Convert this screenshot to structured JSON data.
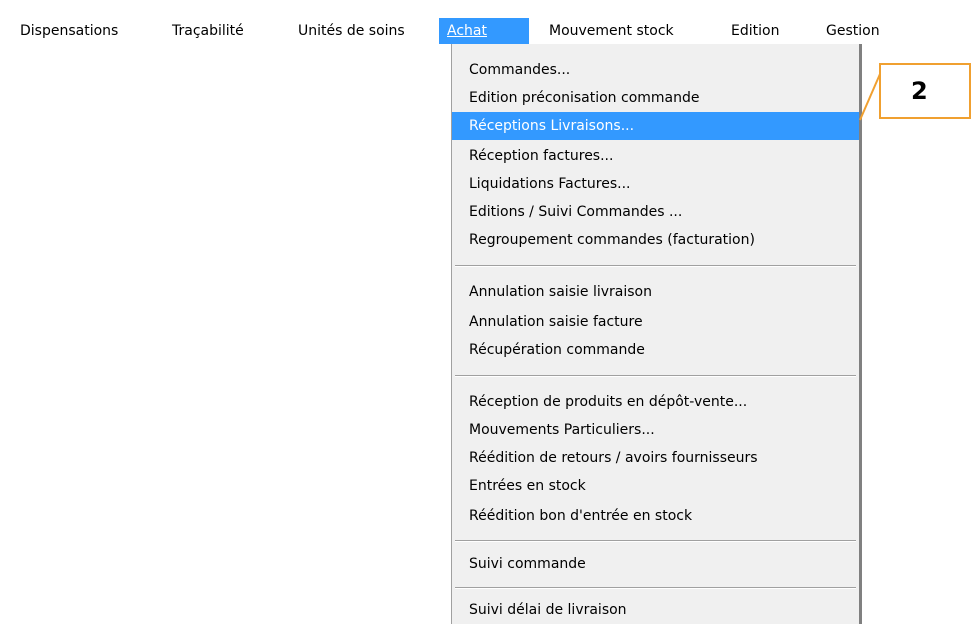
{
  "menubar": {
    "items": [
      {
        "label": "Dispensations"
      },
      {
        "label": "Traçabilité"
      },
      {
        "label": "Unités de soins"
      },
      {
        "label": "Achat"
      },
      {
        "label": "Mouvement stock"
      },
      {
        "label": "Edition"
      },
      {
        "label": "Gestion"
      }
    ]
  },
  "dropdown": {
    "items": [
      {
        "label": "Commandes..."
      },
      {
        "label": "Edition préconisation commande"
      },
      {
        "label": "Réceptions Livraisons..."
      },
      {
        "label": "Réception factures..."
      },
      {
        "label": "Liquidations Factures..."
      },
      {
        "label": "Editions / Suivi Commandes ..."
      },
      {
        "label": "Regroupement commandes (facturation)"
      },
      {
        "label": "Annulation saisie livraison"
      },
      {
        "label": "Annulation saisie facture"
      },
      {
        "label": "Récupération commande"
      },
      {
        "label": "Réception de produits en dépôt-vente..."
      },
      {
        "label": "Mouvements Particuliers..."
      },
      {
        "label": "Réédition de retours / avoirs fournisseurs"
      },
      {
        "label": "Entrées en stock"
      },
      {
        "label": "Réédition bon d'entrée en stock"
      },
      {
        "label": "Suivi commande"
      },
      {
        "label": "Suivi délai de livraison"
      }
    ]
  },
  "callout": {
    "label": "2"
  },
  "colors": {
    "highlight": "#3399ff",
    "callout_border": "#f0a030",
    "menu_bg": "#f0f0f0"
  }
}
